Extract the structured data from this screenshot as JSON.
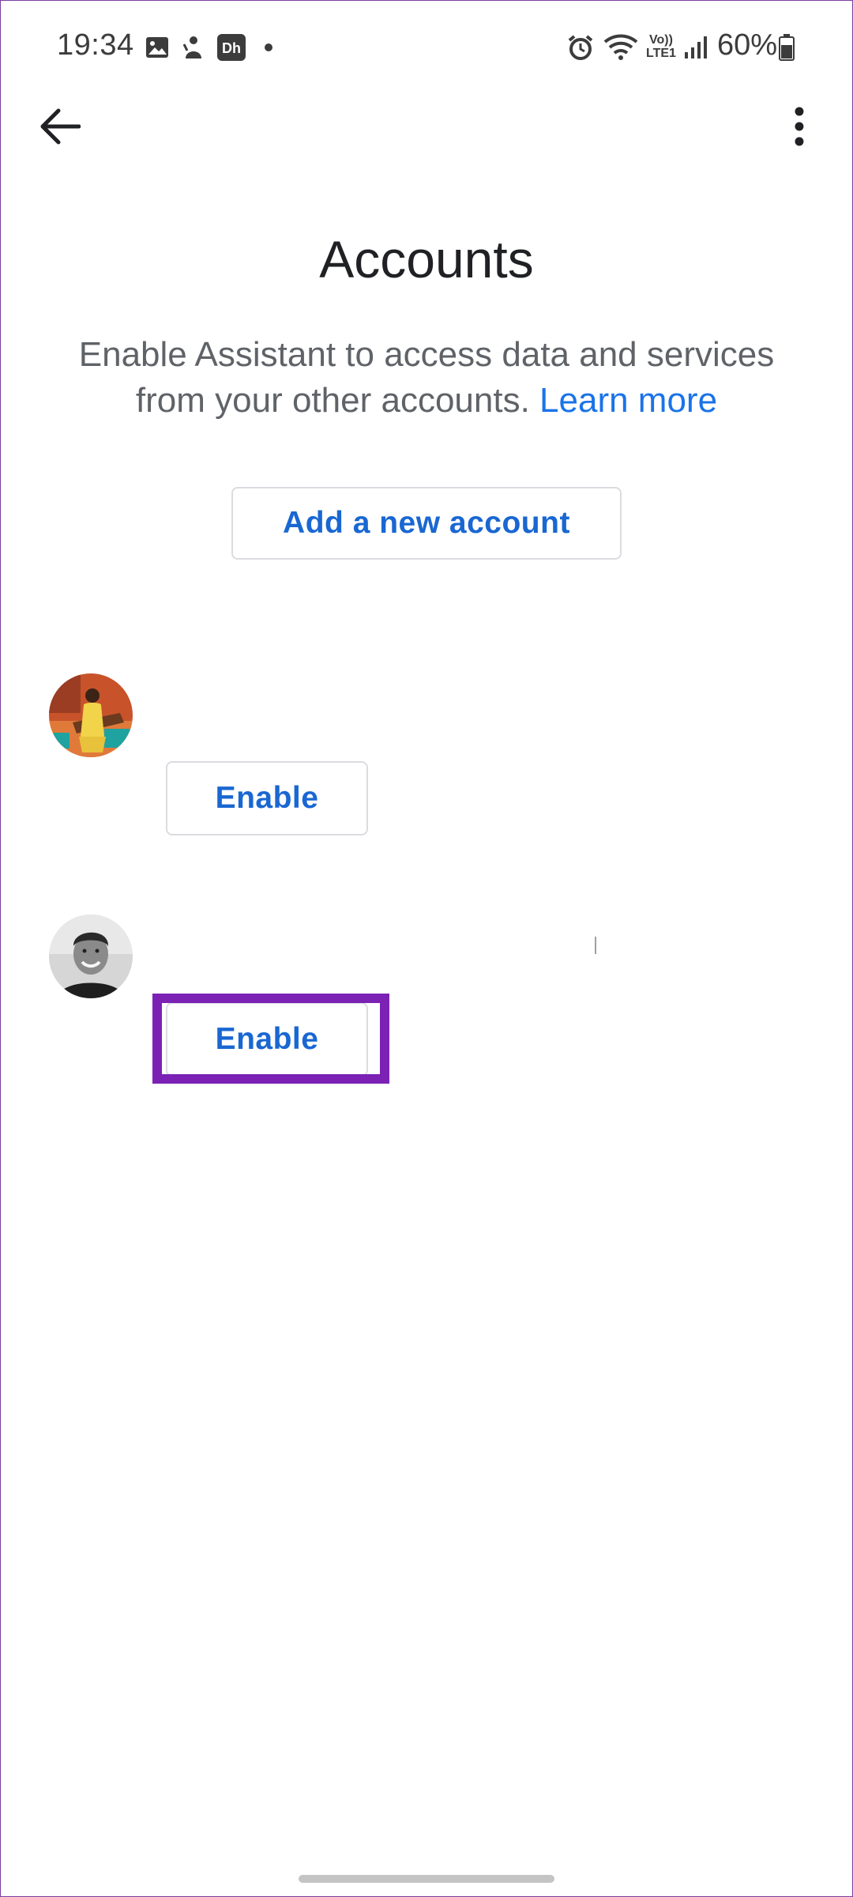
{
  "status_bar": {
    "time": "19:34",
    "battery_percent": "60%",
    "network_label_top": "Vo))",
    "network_label_bottom": "LTE1",
    "icons": [
      "gallery-icon",
      "app-notification-icon",
      "disney-hotstar-icon",
      "dot-icon",
      "alarm-icon",
      "wifi-icon",
      "volte-icon",
      "signal-icon",
      "battery-icon"
    ]
  },
  "toolbar": {
    "back_icon": "arrow-back-icon",
    "more_icon": "more-vert-icon"
  },
  "page": {
    "title": "Accounts",
    "description": "Enable Assistant to access data and services from your other accounts.",
    "learn_more": "Learn more",
    "add_account_label": "Add a new account"
  },
  "accounts": [
    {
      "enable_label": "Enable"
    },
    {
      "enable_label": "Enable"
    }
  ],
  "colors": {
    "accent_blue": "#1967d2",
    "link_blue": "#1a73e8",
    "highlight_purple": "#7b22b5",
    "text_primary": "#202124",
    "text_secondary": "#5f6368"
  }
}
